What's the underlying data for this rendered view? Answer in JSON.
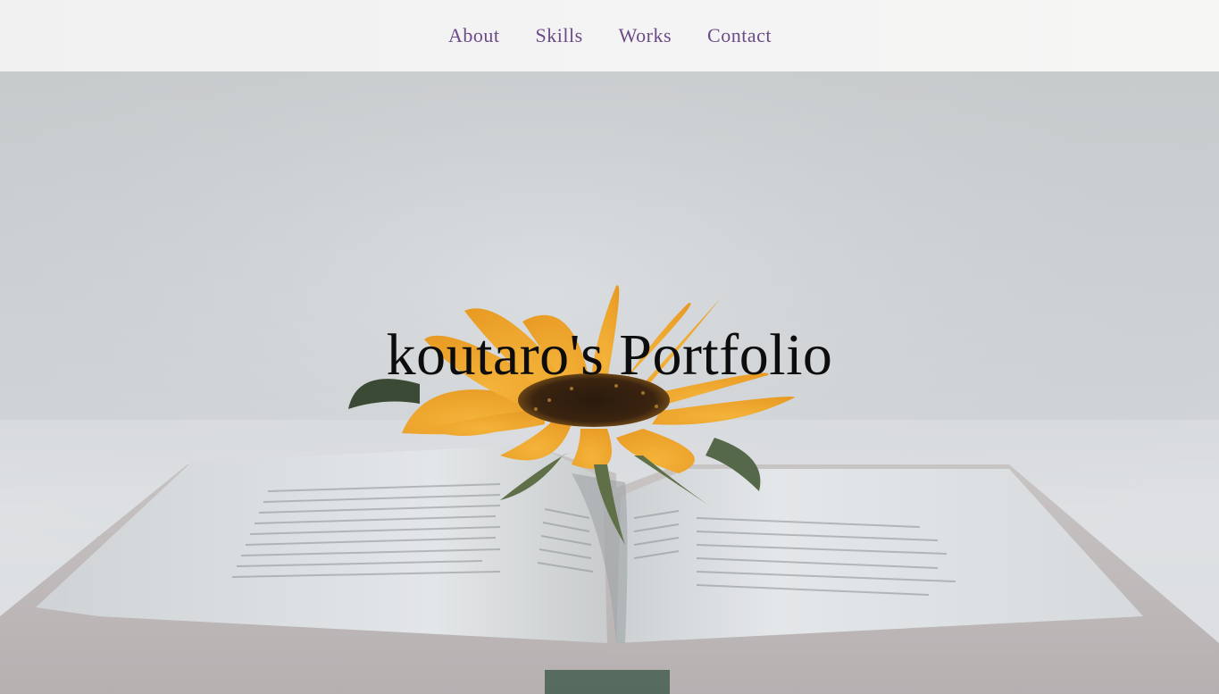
{
  "nav": {
    "items": [
      {
        "label": "About"
      },
      {
        "label": "Skills"
      },
      {
        "label": "Works"
      },
      {
        "label": "Contact"
      }
    ]
  },
  "hero": {
    "title": "koutaro's Portfolio",
    "image": "sunflower-on-open-book-photo"
  },
  "colors": {
    "nav_link": "#6b4a87",
    "header_bg": "#f3f3f3",
    "title": "#0d0d0d"
  }
}
